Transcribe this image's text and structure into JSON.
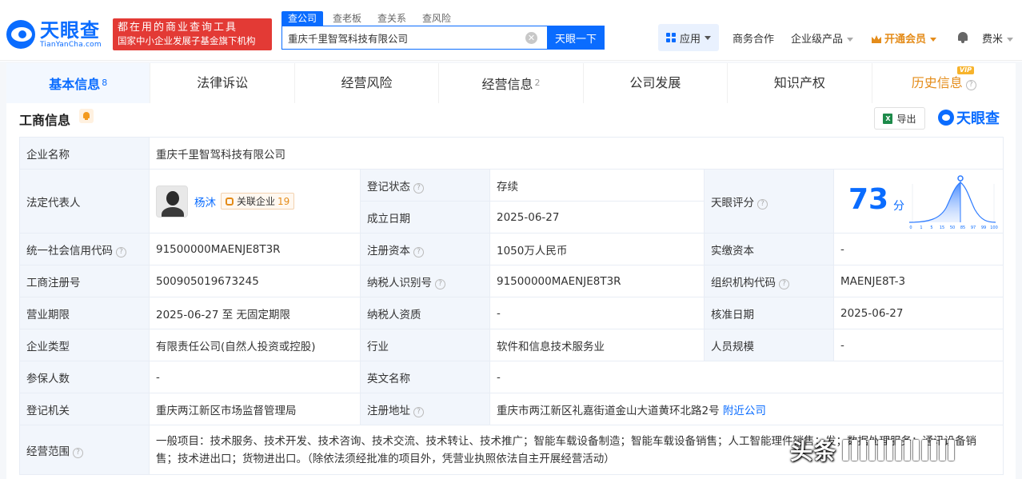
{
  "header": {
    "logo_cn": "天眼查",
    "logo_en": "TianYanCha.com",
    "slogan_line1": "都在用的商业查询工具",
    "slogan_line2": "国家中小企业发展子基金旗下机构",
    "search_tabs": [
      "查公司",
      "查老板",
      "查关系",
      "查风险"
    ],
    "search_value": "重庆千里智驾科技有限公司",
    "search_button": "天眼一下",
    "apps_label": "应用",
    "business_label": "商务合作",
    "enterprise_label": "企业级产品",
    "vip_label": "开通会员",
    "user_label": "费米"
  },
  "tabs": [
    {
      "label": "基本信息",
      "count": "8"
    },
    {
      "label": "法律诉讼",
      "count": ""
    },
    {
      "label": "经营风险",
      "count": ""
    },
    {
      "label": "经营信息",
      "count": "2"
    },
    {
      "label": "公司发展",
      "count": ""
    },
    {
      "label": "知识产权",
      "count": ""
    },
    {
      "label": "历史信息",
      "count": "",
      "badge": "VIP"
    }
  ],
  "section": {
    "title": "工商信息",
    "export_label": "导出",
    "brand": "天眼查"
  },
  "company": {
    "name_label": "企业名称",
    "name": "重庆千里智驾科技有限公司",
    "legal_rep_label": "法定代表人",
    "legal_rep": "杨沐",
    "related_label": "关联企业",
    "related_count": "19",
    "reg_status_label": "登记状态",
    "reg_status": "存续",
    "founded_label": "成立日期",
    "founded": "2025-06-27",
    "score_label": "天眼评分",
    "score": "73",
    "score_unit": "分",
    "score_ticks": [
      "0",
      "1",
      "5",
      "15",
      "50",
      "85",
      "97",
      "99",
      "100"
    ],
    "credit_code_label": "统一社会信用代码",
    "credit_code": "91500000MAENJE8T3R",
    "reg_capital_label": "注册资本",
    "reg_capital": "1050万人民币",
    "paid_capital_label": "实缴资本",
    "paid_capital": "-",
    "reg_no_label": "工商注册号",
    "reg_no": "500905019673245",
    "taxpayer_id_label": "纳税人识别号",
    "taxpayer_id": "91500000MAENJE8T3R",
    "org_code_label": "组织机构代码",
    "org_code": "MAENJE8T-3",
    "term_label": "营业期限",
    "term": "2025-06-27 至 无固定期限",
    "taxpayer_qual_label": "纳税人资质",
    "taxpayer_qual": "-",
    "approval_label": "核准日期",
    "approval": "2025-06-27",
    "type_label": "企业类型",
    "type": "有限责任公司(自然人投资或控股)",
    "industry_label": "行业",
    "industry": "软件和信息技术服务业",
    "staff_label": "人员规模",
    "staff": "-",
    "insured_label": "参保人数",
    "insured": "-",
    "english_label": "英文名称",
    "english": "-",
    "authority_label": "登记机关",
    "authority": "重庆两江新区市场监督管理局",
    "address_label": "注册地址",
    "address": "重庆市两江新区礼嘉街道金山大道黄环北路2号",
    "nearby_label": "附近公司",
    "scope_label": "经营范围",
    "scope": "一般项目：技术服务、技术开发、技术咨询、技术交流、技术转让、技术推广；智能车载设备制造；智能车载设备销售；人工智能理件销售；发；数据处理服务；通讯设备销售；技术进出口；货物进出口。（除依法须经批准的项目外，凭营业执照依法自主开展经营活动）"
  },
  "watermark": "头条"
}
